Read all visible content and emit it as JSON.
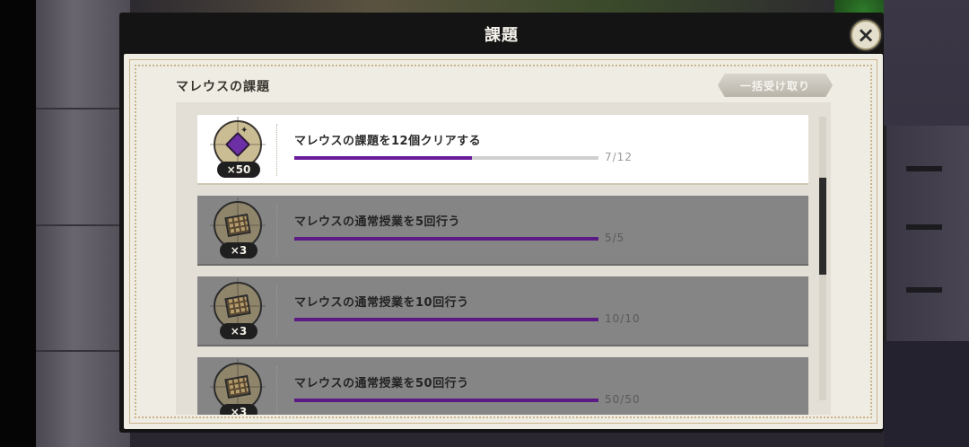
{
  "dialog": {
    "title": "課題",
    "close_icon": "×"
  },
  "section": {
    "title": "マレウスの課題",
    "claim_all_label": "一括受け取り"
  },
  "missions": [
    {
      "text": "マレウスの課題を12個クリアする",
      "progress": "7/12",
      "progress_ratio": 0.583,
      "reward_icon": "gem-icon",
      "reward_count": "×50",
      "completed": false
    },
    {
      "text": "マレウスの通常授業を5回行う",
      "progress": "5/5",
      "progress_ratio": 1.0,
      "reward_icon": "waffle-icon",
      "reward_count": "×3",
      "completed": true
    },
    {
      "text": "マレウスの通常授業を10回行う",
      "progress": "10/10",
      "progress_ratio": 1.0,
      "reward_icon": "waffle-icon",
      "reward_count": "×3",
      "completed": true
    },
    {
      "text": "マレウスの通常授業を50回行う",
      "progress": "50/50",
      "progress_ratio": 1.0,
      "reward_icon": "waffle-icon",
      "reward_count": "×3",
      "completed": true
    }
  ],
  "colors": {
    "progress_fill": "#6a1b9a",
    "panel_bg": "#efece4",
    "header_bg": "#141414",
    "completed_row": "#858585"
  }
}
